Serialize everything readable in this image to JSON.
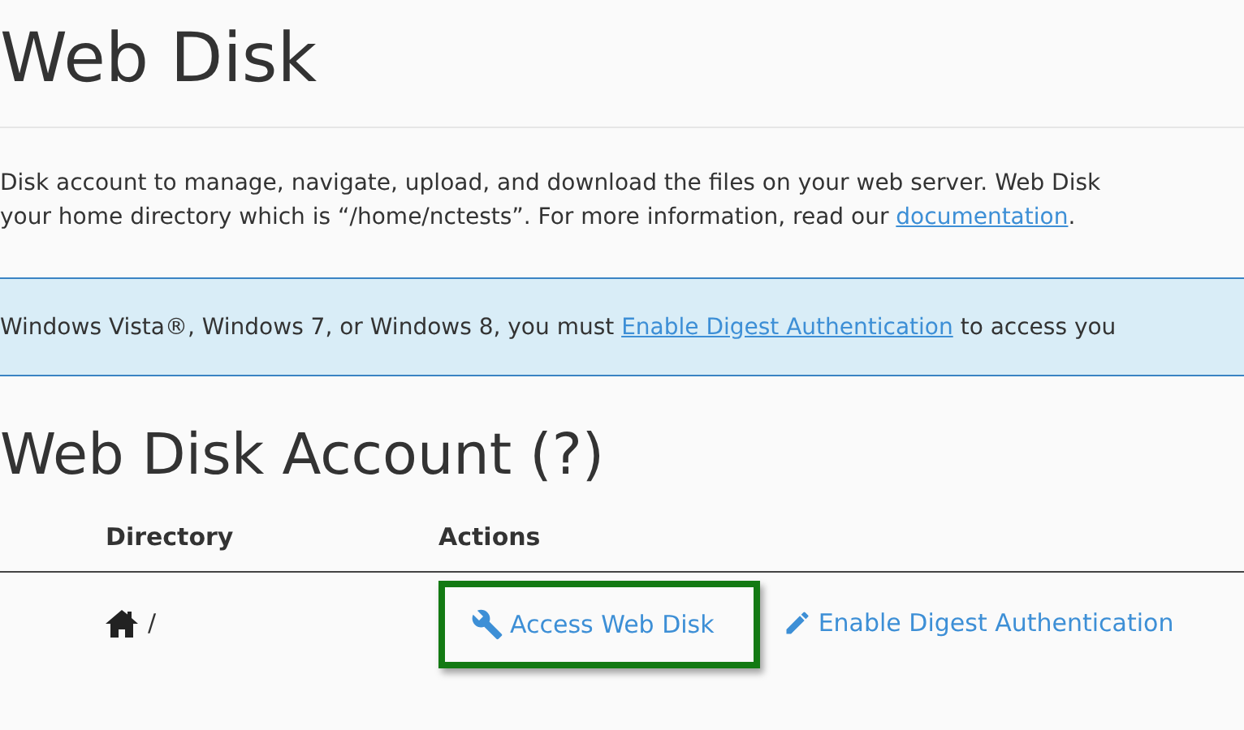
{
  "page_title": "Web Disk",
  "description": {
    "line_1": "Disk account to manage, navigate, upload, and download the files on your web server. Web Disk",
    "line_2_before": "your home directory which is “/home/nctests”. For more information, read our",
    "line_2_link": "documentation",
    "line_2_after": "."
  },
  "notice": {
    "before": "Windows Vista®, Windows 7, or Windows 8, you must",
    "link": "Enable Digest Authentication",
    "after": "to access you"
  },
  "section_title": "Web Disk Account (?)",
  "table": {
    "columns": [
      "Directory",
      "Actions"
    ],
    "rows": [
      {
        "directory": "/",
        "actions": [
          {
            "label": "Access Web Disk",
            "kind": "wrench",
            "highlighted": true
          },
          {
            "label": "Enable Digest Authentication",
            "kind": "pencil",
            "highlighted": false
          }
        ]
      }
    ]
  }
}
